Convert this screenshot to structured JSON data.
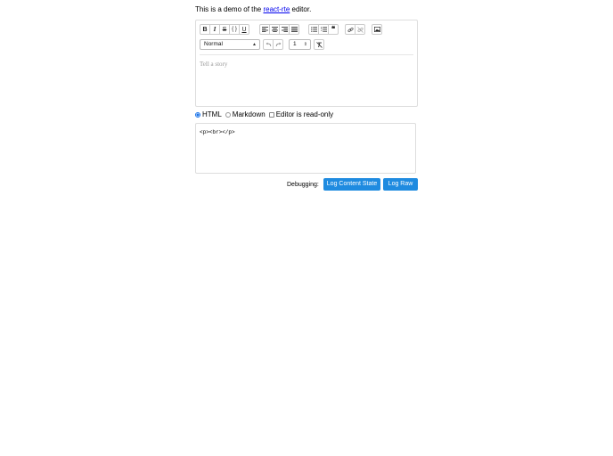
{
  "intro": {
    "prefix": "This is a demo of the ",
    "link": "react-rte",
    "suffix": " editor."
  },
  "toolbar": {
    "bold": "B",
    "italic": "I",
    "strikethrough": "S",
    "code": "{ }",
    "underline": "U",
    "blockquote": "❝",
    "block_type": "Normal",
    "font_size": "1"
  },
  "editor": {
    "placeholder": "Tell a story"
  },
  "format_options": [
    {
      "label": "HTML",
      "checked": true
    },
    {
      "label": "Markdown",
      "checked": false
    }
  ],
  "readonly_label": "Editor is read-only",
  "source_value": "<p><br></p>",
  "debug": {
    "label": "Debugging:",
    "log_content_state": "Log Content State",
    "log_raw": "Log Raw"
  },
  "colors": {
    "accent": "#1f8be0",
    "link": "#0000ee"
  },
  "icons": [
    "align-left-icon",
    "align-center-icon",
    "align-right-icon",
    "align-justify-icon",
    "bullet-list-icon",
    "numbered-list-icon",
    "quote-icon",
    "link-icon",
    "unlink-icon",
    "image-icon",
    "undo-icon",
    "redo-icon",
    "clear-format-icon"
  ]
}
